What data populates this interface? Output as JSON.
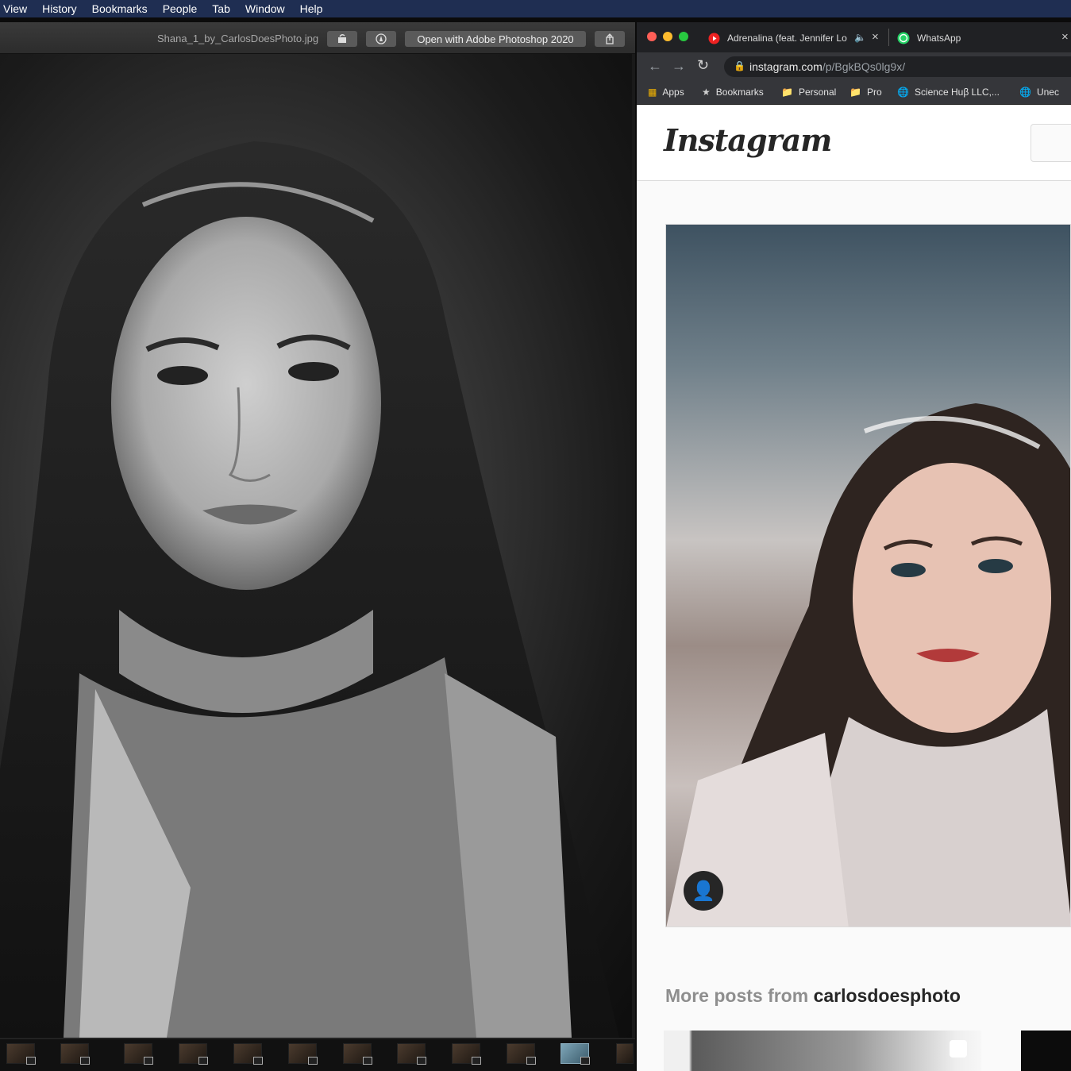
{
  "menubar": {
    "items": [
      "View",
      "History",
      "Bookmarks",
      "People",
      "Tab",
      "Window",
      "Help"
    ]
  },
  "preview": {
    "filename": "Shana_1_by_CarlosDoesPhoto.jpg",
    "open_with_label": "Open with Adobe Photoshop 2020",
    "filmstrip_count": 12
  },
  "chrome": {
    "tabs": [
      {
        "title": "Adrenalina (feat. Jennifer Lo",
        "icon": "youtube-icon"
      },
      {
        "title": "WhatsApp",
        "icon": "whatsapp-icon"
      }
    ],
    "url_host": "instagram.com",
    "url_path": "/p/BgkBQs0lg9x/",
    "bookmarks": [
      "Apps",
      "Bookmarks",
      "Personal",
      "Pro",
      "Science Huβ LLC,...",
      "Unec"
    ]
  },
  "instagram": {
    "logo": "Instagram",
    "more_posts_prefix": "More posts from ",
    "more_posts_user": "carlosdoesphoto"
  },
  "colors": {
    "menubar": "#1f2e52",
    "chrome_dark": "#202124",
    "ig_text": "#262626"
  }
}
